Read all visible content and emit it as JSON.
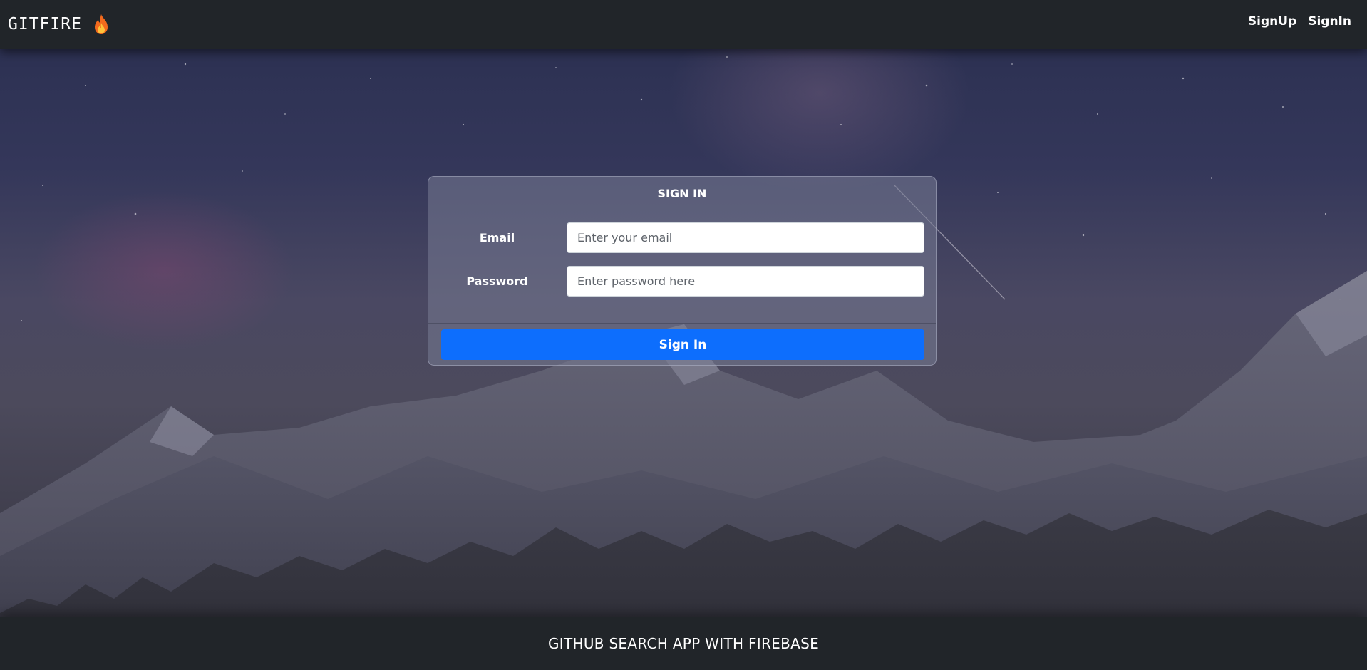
{
  "navbar": {
    "brand": "GITFIRE",
    "brand_icon": "fire-icon",
    "links": [
      {
        "label": "SignUp"
      },
      {
        "label": "SignIn"
      }
    ]
  },
  "signin_card": {
    "title": "SIGN IN",
    "email": {
      "label": "Email",
      "placeholder": "Enter your email",
      "value": ""
    },
    "password": {
      "label": "Password",
      "placeholder": "Enter password here",
      "value": ""
    },
    "submit_label": "Sign In"
  },
  "footer": {
    "text": "GITHUB SEARCH APP WITH FIREBASE"
  },
  "colors": {
    "nav_bg": "#212529",
    "primary_button": "#0d6efd",
    "text": "#ffffff"
  }
}
